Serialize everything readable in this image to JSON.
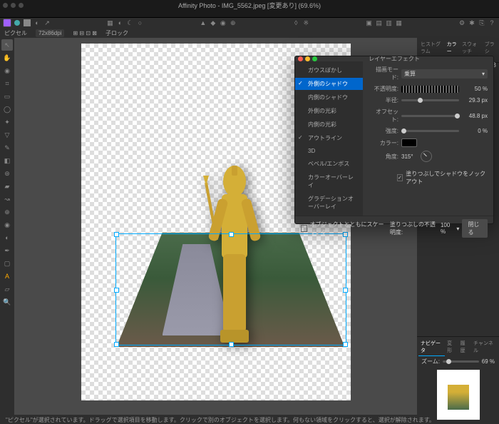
{
  "app_title": "Affinity Photo - IMG_5562.jpeg [変更あり] (69.6%)",
  "ctx": {
    "label": "ピクセル",
    "resolution": "72x86dpi",
    "lock": "子ロック"
  },
  "right": {
    "tabs": {
      "histogram": "ヒストグラム",
      "color": "カラー",
      "swatches": "スウォッチ",
      "brushes": "ブラシ"
    },
    "mode": "RGB",
    "nav": {
      "tab": "ナビゲータ",
      "zoom_label": "ズーム:",
      "zoom_val": "69 %"
    }
  },
  "dialog": {
    "title": "レイヤーエフェクト",
    "fx": {
      "gaussian_blur": "ガウスぼかし",
      "outer_shadow": "外側のシャドウ",
      "inner_shadow": "内側のシャドウ",
      "outer_glow": "外側の光彩",
      "inner_glow": "内側の光彩",
      "outline": "アウトライン",
      "three_d": "3D",
      "bevel": "ベベル/エンボス",
      "color_overlay": "カラーオーバーレイ",
      "gradient_overlay": "グラデーションオーバーレイ"
    },
    "params": {
      "blend_label": "描画モード:",
      "blend_value": "乗算",
      "opacity_label": "不透明度:",
      "opacity_value": "50 %",
      "radius_label": "半径:",
      "radius_value": "29.3 px",
      "offset_label": "オフセット:",
      "offset_value": "48.8 px",
      "intensity_label": "強度:",
      "intensity_value": "0 %",
      "color_label": "カラー:",
      "angle_label": "角度:",
      "angle_value": "315°",
      "knockout": "塗りつぶしでシャドウをノックアウト"
    },
    "footer": {
      "scale_with": "オブジェクトとともにスケーリング",
      "fill_opacity_label": "塗りつぶしの不透明度:",
      "fill_opacity_value": "100 %",
      "close": "閉じる"
    }
  },
  "status": "\"ピクセル\"が選択されています。ドラッグで選択項目を移動します。クリックで別のオブジェクトを選択します。何もない領域をクリックすると、選択が解除されます。"
}
